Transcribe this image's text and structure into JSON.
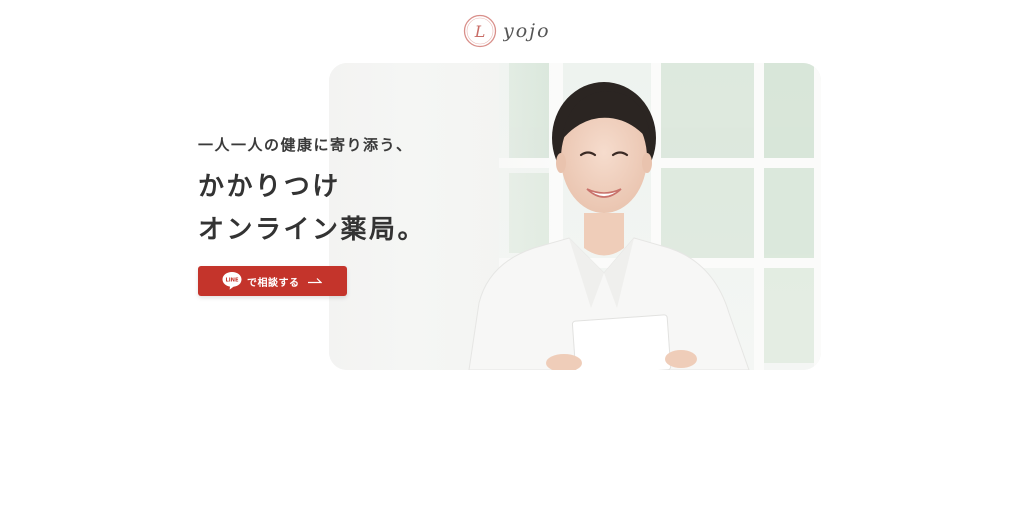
{
  "header": {
    "logo_text": "yojo",
    "emblem_letter": "L",
    "icons": {
      "emblem": "circle-emblem-icon"
    }
  },
  "hero": {
    "tagline": "一人一人の健康に寄り添う、",
    "headline_line1": "かかりつけ",
    "headline_line2": "オンライン薬局。",
    "image": "pharmacist-photo"
  },
  "cta": {
    "line_badge": "LINE",
    "label": "で相談する",
    "icons": {
      "line": "line-app-icon",
      "arrow": "arrow-right-icon"
    }
  },
  "colors": {
    "accent": "#c4342b",
    "text": "#333333",
    "logo_pink": "#d98f8a",
    "background": "#ffffff"
  }
}
